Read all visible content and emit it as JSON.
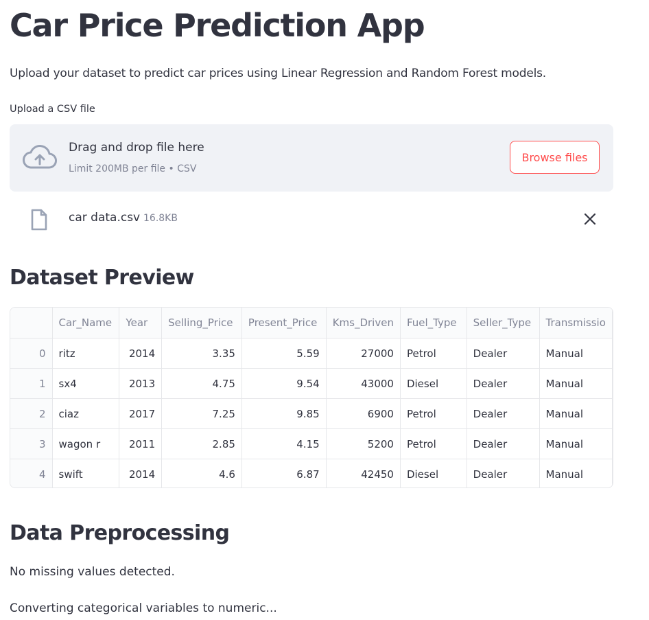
{
  "app": {
    "title": "Car Price Prediction App",
    "subtitle": "Upload your dataset to predict car prices using Linear Regression and Random Forest models."
  },
  "uploader": {
    "label": "Upload a CSV file",
    "drop_text": "Drag and drop file here",
    "limit_text": "Limit 200MB per file • CSV",
    "browse_label": "Browse files",
    "file_name": "car data.csv",
    "file_size": "16.8KB",
    "icons": [
      "cloud-upload-icon",
      "file-icon",
      "close-icon"
    ]
  },
  "preview": {
    "heading": "Dataset Preview",
    "columns": [
      "",
      "Car_Name",
      "Year",
      "Selling_Price",
      "Present_Price",
      "Kms_Driven",
      "Fuel_Type",
      "Seller_Type",
      "Transmissio"
    ],
    "rows": [
      [
        "0",
        "ritz",
        "2014",
        "3.35",
        "5.59",
        "27000",
        "Petrol",
        "Dealer",
        "Manual"
      ],
      [
        "1",
        "sx4",
        "2013",
        "4.75",
        "9.54",
        "43000",
        "Diesel",
        "Dealer",
        "Manual"
      ],
      [
        "2",
        "ciaz",
        "2017",
        "7.25",
        "9.85",
        "6900",
        "Petrol",
        "Dealer",
        "Manual"
      ],
      [
        "3",
        "wagon r",
        "2011",
        "2.85",
        "4.15",
        "5200",
        "Petrol",
        "Dealer",
        "Manual"
      ],
      [
        "4",
        "swift",
        "2014",
        "4.6",
        "6.87",
        "42450",
        "Diesel",
        "Dealer",
        "Manual"
      ]
    ]
  },
  "preprocessing": {
    "heading": "Data Preprocessing",
    "missing_msg": "No missing values detected.",
    "convert_msg": "Converting categorical variables to numeric..."
  },
  "colors": {
    "accent": "#ff4b4b",
    "text": "#31333f",
    "muted": "#808495",
    "dropzone_bg": "#f0f2f6"
  }
}
